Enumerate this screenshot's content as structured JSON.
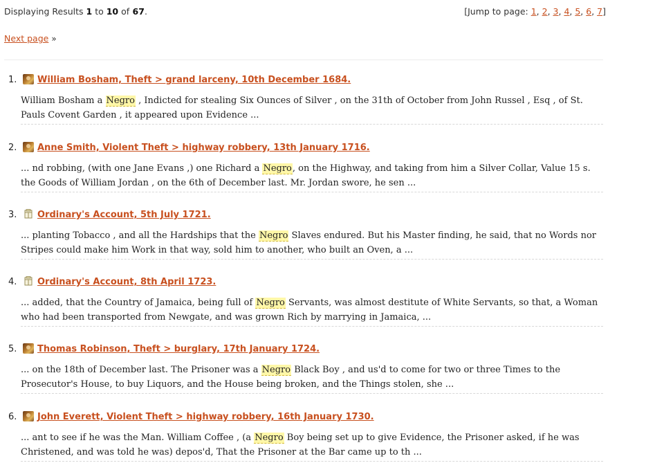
{
  "top": {
    "displaying_prefix": "Displaying Results",
    "from": "1",
    "to_word": "to",
    "to": "10",
    "of_word": "of",
    "total": "67",
    "period": ".",
    "jump_open": "[Jump to page:",
    "pages": [
      "1",
      "2",
      "3",
      "4",
      "5",
      "6",
      "7"
    ],
    "jump_close": "]"
  },
  "next_page": {
    "label": "Next page",
    "arrow": "»"
  },
  "results": [
    {
      "num": "1.",
      "icon": "trial-portrait-icon",
      "title": "William Bosham, Theft > grand larceny, 10th December 1684.",
      "snippet": {
        "before": "William Bosham a ",
        "hit": "Negro",
        "after": " , Indicted for stealing Six Ounces of Silver , on the 31th of October from John Russel , Esq , of St. Pauls Covent Garden , it appeared upon Evidence ..."
      }
    },
    {
      "num": "2.",
      "icon": "trial-portrait-icon",
      "title": "Anne Smith, Violent Theft > highway robbery, 13th January 1716.",
      "snippet": {
        "before": "... nd robbing, (with one Jane Evans ,) one Richard a ",
        "hit": "Negro",
        "after": ", on the Highway, and taking from him a Silver Collar, Value 15 s. the Goods of William Jordan , on the 6th of December last. Mr. Jordan swore, he sen ..."
      }
    },
    {
      "num": "3.",
      "icon": "ordinary-account-icon",
      "title": "Ordinary's Account, 5th July 1721.",
      "snippet": {
        "before": "... planting Tobacco , and all the Hardships that the ",
        "hit": "Negro",
        "after": " Slaves endured. But his Master finding, he said, that no Words nor Stripes could make him Work in that way, sold him to another, who built an Oven, a ..."
      }
    },
    {
      "num": "4.",
      "icon": "ordinary-account-icon",
      "title": "Ordinary's Account, 8th April 1723.",
      "snippet": {
        "before": "... added, that the Country of Jamaica, being full of ",
        "hit": "Negro",
        "after": " Servants, was almost destitute of White Servants, so that, a Woman who had been transported from Newgate, and was grown Rich by marrying in Jamaica, ..."
      }
    },
    {
      "num": "5.",
      "icon": "trial-portrait-icon",
      "title": "Thomas Robinson, Theft > burglary, 17th January 1724.",
      "snippet": {
        "before": "... on the 18th of December last. The Prisoner was a ",
        "hit": "Negro",
        "after": " Black Boy , and us'd to come for two or three Times to the Prosecutor's House, to buy Liquors, and the House being broken, and the Things stolen, she ..."
      }
    },
    {
      "num": "6.",
      "icon": "trial-portrait-icon",
      "title": "John Everett, Violent Theft > highway robbery, 16th January 1730.",
      "snippet": {
        "before": "... ant to see if he was the Man. William Coffee , (a ",
        "hit": "Negro",
        "after": " Boy being set up to give Evidence, the Prisoner asked, if he was Christened, and was told he was) depos'd, That the Prisoner at the Bar came up to th ..."
      }
    }
  ]
}
